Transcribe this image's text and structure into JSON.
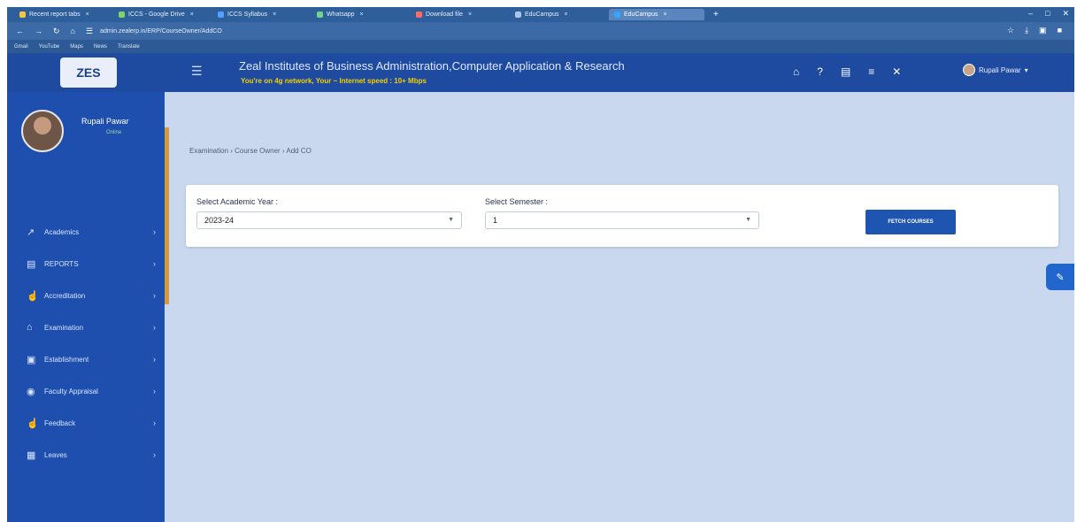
{
  "browser": {
    "tabs": [
      {
        "label": "Recent report tabs",
        "color": "#f4c542"
      },
      {
        "label": "ICCS - Google Drive",
        "color": "#7fd36b"
      },
      {
        "label": "ICCS Syllabus",
        "color": "#4fa3ff"
      },
      {
        "label": "Whatsapp",
        "color": "#74d38a"
      },
      {
        "label": "Download file",
        "color": "#ff6b6b"
      },
      {
        "label": "EduCampus",
        "color": "#a9c4ea"
      },
      {
        "label": "EduCampus",
        "color": "#33a6ff",
        "active": true
      }
    ],
    "url": "admin.zealerp.in/ERP/CourseOwner/AddCO",
    "bookmarks": [
      "Gmail",
      "YouTube",
      "Maps",
      "News",
      "Translate"
    ]
  },
  "header": {
    "logo_text": "ZES",
    "institute": "Zeal Institutes of Business Administration,Computer Application & Research",
    "network": "You're on 4g network, Your ~ Internet speed : 10+ Mbps",
    "user": "Rupali Pawar"
  },
  "profile": {
    "name": "Rupali Pawar",
    "status": "Online"
  },
  "sidebar": {
    "items": [
      {
        "label": "Academics",
        "icon": "chart-icon"
      },
      {
        "label": "REPORTS",
        "icon": "report-icon"
      },
      {
        "label": "Accreditation",
        "icon": "thumbs-up-icon"
      },
      {
        "label": "Examination",
        "icon": "bank-icon"
      },
      {
        "label": "Establishment",
        "icon": "building-icon"
      },
      {
        "label": "Faculty Appraisal",
        "icon": "chat-icon"
      },
      {
        "label": "Feedback",
        "icon": "thumbs-up-icon"
      },
      {
        "label": "Leaves",
        "icon": "calendar-icon"
      }
    ]
  },
  "breadcrumb": "Examination › Course Owner › Add CO",
  "form": {
    "year_label": "Select Academic Year :",
    "year_value": "2023-24",
    "semester_label": "Select Semester :",
    "semester_value": "1",
    "fetch_label": "FETCH COURSES"
  }
}
